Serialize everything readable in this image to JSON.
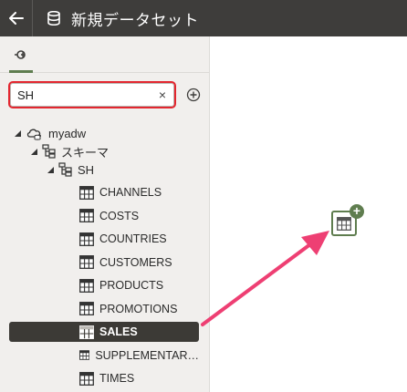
{
  "header": {
    "title": "新規データセット"
  },
  "search": {
    "value": "SH",
    "clear_glyph": "×"
  },
  "tree": {
    "connection": "myadw",
    "schemas_label": "スキーマ",
    "schema": "SH",
    "tables": [
      "CHANNELS",
      "COSTS",
      "COUNTRIES",
      "CUSTOMERS",
      "PRODUCTS",
      "PROMOTIONS",
      "SALES",
      "SUPPLEMENTAR…",
      "TIMES"
    ],
    "selected_table": "SALES"
  },
  "canvas": {
    "plus_glyph": "+"
  },
  "colors": {
    "header_bg": "#3e3d3b",
    "panel_bg": "#f1efed",
    "selected_bg": "#3c3a36",
    "accent_green": "#5f7d4f",
    "highlight_red": "#e3262f",
    "arrow_pink": "#ee3f73"
  },
  "icons": {
    "back": "arrow-left-icon",
    "header": "database-icon",
    "tab": "connection-plug-icon",
    "add": "plus-circle-icon",
    "connection": "cloud-database-icon",
    "schema": "schema-icon",
    "table": "table-icon"
  }
}
